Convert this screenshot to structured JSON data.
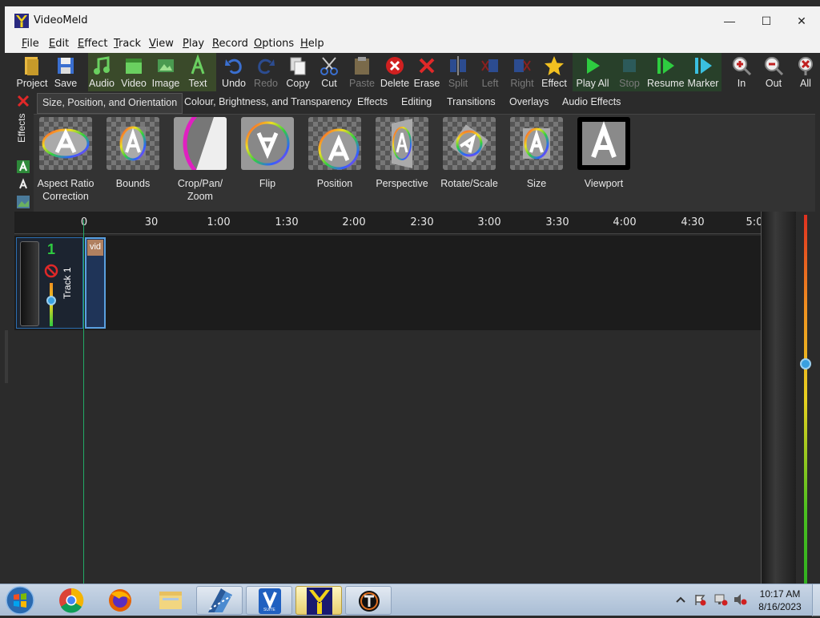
{
  "window": {
    "title": "VideoMeld",
    "minimize_glyph": "—",
    "maximize_glyph": "☐",
    "close_glyph": "✕"
  },
  "menu": [
    {
      "label": "File",
      "accel": "F",
      "rest": "ile"
    },
    {
      "label": "Edit",
      "accel": "E",
      "rest": "dit"
    },
    {
      "label": "Effect",
      "accel": "E",
      "rest": "ffect"
    },
    {
      "label": "Track",
      "accel": "T",
      "rest": "rack"
    },
    {
      "label": "View",
      "accel": "V",
      "rest": "iew"
    },
    {
      "label": "Play",
      "accel": "P",
      "rest": "lay"
    },
    {
      "label": "Record",
      "accel": "R",
      "rest": "ecord"
    },
    {
      "label": "Options",
      "accel": "O",
      "rest": "ptions"
    },
    {
      "label": "Help",
      "accel": "H",
      "rest": "elp"
    }
  ],
  "toolbar": {
    "project": "Project",
    "save": "Save",
    "audio": "Audio",
    "video": "Video",
    "image": "Image",
    "text": "Text",
    "undo": "Undo",
    "redo": "Redo",
    "copy": "Copy",
    "cut": "Cut",
    "paste": "Paste",
    "delete": "Delete",
    "erase": "Erase",
    "split": "Split",
    "left": "Left",
    "right": "Right",
    "effect": "Effect",
    "play_all": "Play All",
    "stop": "Stop",
    "resume": "Resume",
    "marker": "Marker",
    "zoom_in": "In",
    "zoom_out": "Out",
    "zoom_all": "All"
  },
  "effects_panel": {
    "side_label": "Effects",
    "tabs": [
      "Size, Position, and Orientation",
      "Colour, Brightness, and Transparency",
      "Effects",
      "Editing",
      "Transitions",
      "Overlays",
      "Audio Effects"
    ],
    "items": [
      {
        "label": "Aspect Ratio Correction",
        "line1": "Aspect Ratio",
        "line2": "Correction"
      },
      {
        "label": "Bounds",
        "line1": "Bounds",
        "line2": ""
      },
      {
        "label": "Crop/Pan/ Zoom",
        "line1": "Crop/Pan/",
        "line2": "Zoom"
      },
      {
        "label": "Flip",
        "line1": "Flip",
        "line2": ""
      },
      {
        "label": "Position",
        "line1": "Position",
        "line2": ""
      },
      {
        "label": "Perspective",
        "line1": "Perspective",
        "line2": ""
      },
      {
        "label": "Rotate/Scale",
        "line1": "Rotate/Scale",
        "line2": ""
      },
      {
        "label": "Size",
        "line1": "Size",
        "line2": ""
      },
      {
        "label": "Viewport",
        "line1": "Viewport",
        "line2": ""
      }
    ]
  },
  "timeline": {
    "ruler_ticks": [
      "0",
      "30",
      "1:00",
      "1:30",
      "2:00",
      "2:30",
      "3:00",
      "3:30",
      "4:00",
      "4:30",
      "5:0"
    ],
    "track": {
      "number": "1",
      "name": "Track 1",
      "clip_label": "vid"
    }
  },
  "taskbar": {
    "time": "10:17 AM",
    "date": "8/16/2023",
    "suite_label": "SUITE"
  },
  "colors": {
    "accent_green": "#22aa66",
    "track_blue": "#2b6db0",
    "play_green": "#2ecc40"
  },
  "icons": [
    "windows-start-icon",
    "chrome-icon",
    "firefox-icon",
    "file-explorer-icon",
    "clapper-icon",
    "vsuite-icon",
    "videomeld-icon",
    "t-app-icon"
  ]
}
